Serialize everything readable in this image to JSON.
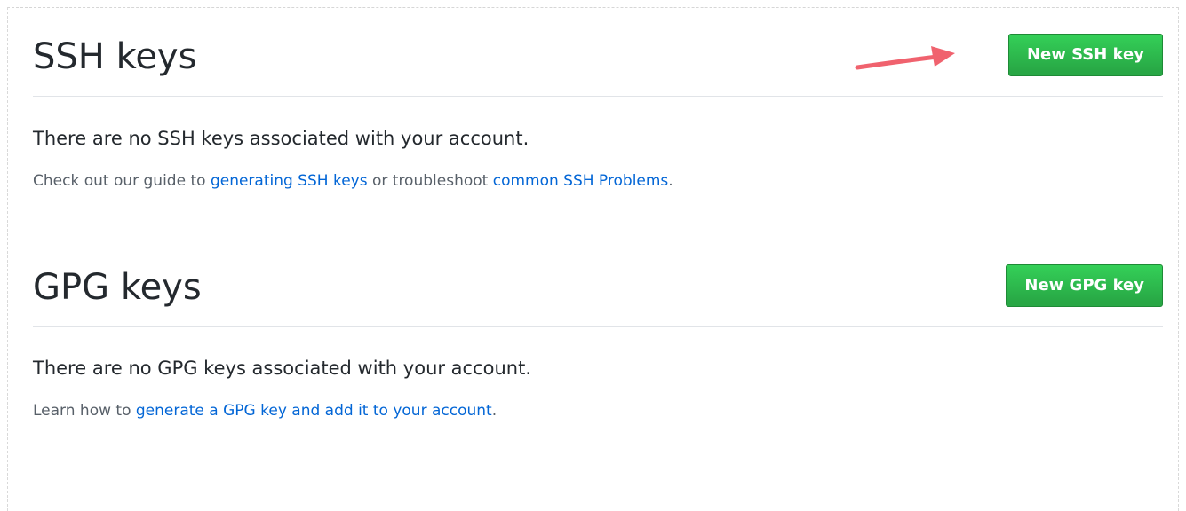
{
  "ssh": {
    "title": "SSH keys",
    "new_button": "New SSH key",
    "empty_message": "There are no SSH keys associated with your account.",
    "help": {
      "prefix": "Check out our guide to ",
      "link1": "generating SSH keys",
      "middle": " or troubleshoot ",
      "link2": "common SSH Problems",
      "suffix": "."
    }
  },
  "gpg": {
    "title": "GPG keys",
    "new_button": "New GPG key",
    "empty_message": "There are no GPG keys associated with your account.",
    "help": {
      "prefix": "Learn how to ",
      "link": "generate a GPG key and add it to your account",
      "suffix": "."
    }
  },
  "colors": {
    "primary_button": "#28a745",
    "link": "#0366d6",
    "annotation_arrow": "#f0626e"
  },
  "annotation": {
    "icon": "arrow-right-icon"
  }
}
